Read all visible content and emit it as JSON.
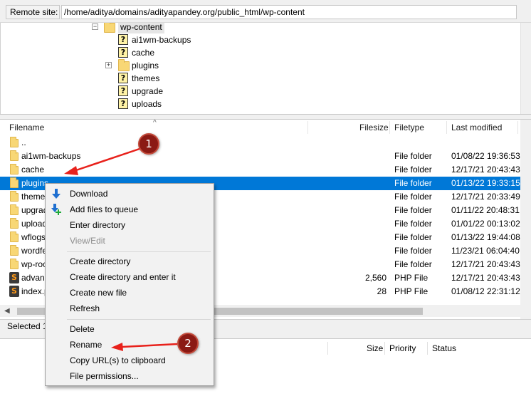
{
  "site_bar": {
    "label": "Remote site:",
    "path": "/home/aditya/domains/adityapandey.org/public_html/wp-content"
  },
  "tree": {
    "current": "wp-content",
    "children": [
      "ai1wm-backups",
      "cache",
      "plugins",
      "themes",
      "upgrade",
      "uploads"
    ]
  },
  "file_list": {
    "headers": {
      "filename": "Filename",
      "filesize": "Filesize",
      "filetype": "Filetype",
      "modified": "Last modified"
    },
    "rows": [
      {
        "name": "..",
        "size": "",
        "type": "",
        "modified": "",
        "icon": "folder-icon"
      },
      {
        "name": "ai1wm-backups",
        "size": "",
        "type": "File folder",
        "modified": "01/08/22 19:36:53",
        "icon": "folder-icon"
      },
      {
        "name": "cache",
        "size": "",
        "type": "File folder",
        "modified": "12/17/21 20:43:43",
        "icon": "folder-icon"
      },
      {
        "name": "plugins",
        "size": "",
        "type": "File folder",
        "modified": "01/13/22 19:33:15",
        "icon": "folder-icon"
      },
      {
        "name": "themes",
        "size": "",
        "type": "File folder",
        "modified": "12/17/21 20:33:49",
        "icon": "folder-icon"
      },
      {
        "name": "upgrade",
        "size": "",
        "type": "File folder",
        "modified": "01/11/22 20:48:31",
        "icon": "folder-icon"
      },
      {
        "name": "uploads",
        "size": "",
        "type": "File folder",
        "modified": "01/01/22 00:13:02",
        "icon": "folder-icon"
      },
      {
        "name": "wflogs",
        "size": "",
        "type": "File folder",
        "modified": "01/13/22 19:44:08",
        "icon": "folder-icon"
      },
      {
        "name": "wordfence",
        "size": "",
        "type": "File folder",
        "modified": "11/23/21 06:04:40",
        "icon": "folder-icon"
      },
      {
        "name": "wp-rocket",
        "size": "",
        "type": "File folder",
        "modified": "12/17/21 20:43:43",
        "icon": "folder-icon"
      },
      {
        "name": "advanced-cache.php",
        "size": "2,560",
        "type": "PHP File",
        "modified": "12/17/21 20:43:43",
        "icon": "php-file-icon"
      },
      {
        "name": "index.php",
        "size": "28",
        "type": "PHP File",
        "modified": "01/08/12 22:31:12",
        "icon": "php-file-icon"
      }
    ],
    "selected": "plugins"
  },
  "status": "Selected 1",
  "queue": {
    "headers": {
      "size": "Size",
      "priority": "Priority",
      "status": "Status"
    }
  },
  "context_menu": {
    "items": [
      {
        "label": "Download",
        "icon": "download-icon",
        "disabled": false
      },
      {
        "label": "Add files to queue",
        "icon": "add-to-queue-icon",
        "disabled": false
      },
      {
        "label": "Enter directory",
        "disabled": false
      },
      {
        "label": "View/Edit",
        "disabled": true
      },
      {
        "label": "Create directory",
        "disabled": false
      },
      {
        "label": "Create directory and enter it",
        "disabled": false
      },
      {
        "label": "Create new file",
        "disabled": false
      },
      {
        "label": "Refresh",
        "disabled": false
      },
      {
        "label": "Delete",
        "disabled": false
      },
      {
        "label": "Rename",
        "disabled": false
      },
      {
        "label": "Copy URL(s) to clipboard",
        "disabled": false
      },
      {
        "label": "File permissions...",
        "disabled": false
      }
    ]
  },
  "annotations": {
    "marker_1": "1",
    "marker_2": "2",
    "color": "#e8211b"
  }
}
